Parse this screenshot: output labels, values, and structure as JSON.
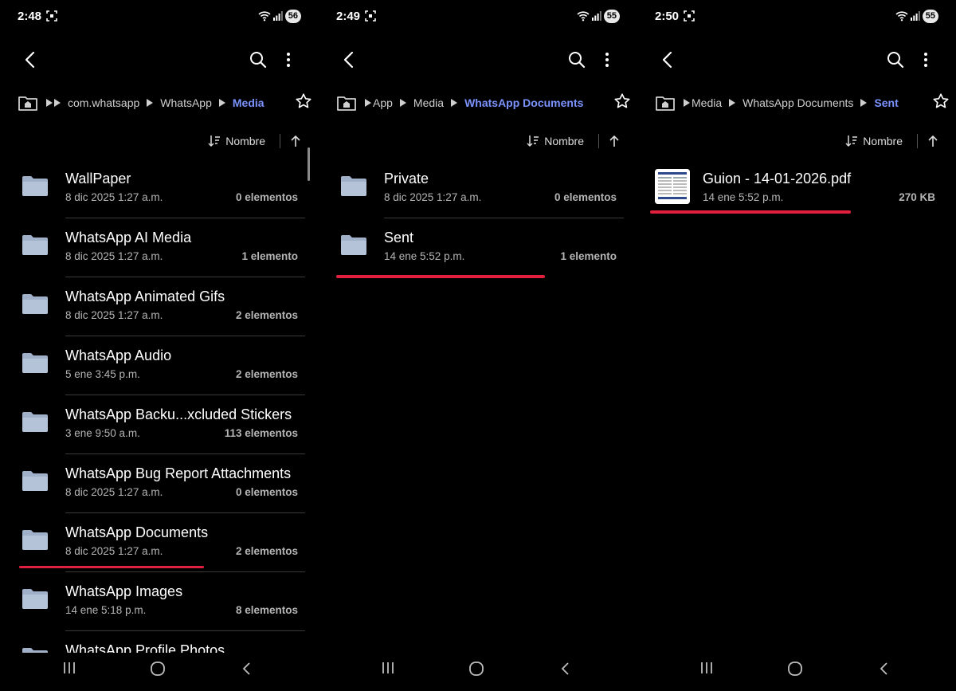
{
  "screens": [
    {
      "status": {
        "time": "2:48",
        "battery": "56"
      },
      "breadcrumbs": [
        "com.whatsapp",
        "WhatsApp",
        "Media"
      ],
      "sort_label": "Nombre",
      "items": [
        {
          "name": "WallPaper",
          "date": "8 dic 2025 1:27 a.m.",
          "count": "0 elementos"
        },
        {
          "name": "WhatsApp AI Media",
          "date": "8 dic 2025 1:27 a.m.",
          "count": "1 elemento"
        },
        {
          "name": "WhatsApp Animated Gifs",
          "date": "8 dic 2025 1:27 a.m.",
          "count": "2 elementos"
        },
        {
          "name": "WhatsApp Audio",
          "date": "5 ene 3:45 p.m.",
          "count": "2 elementos"
        },
        {
          "name": "WhatsApp Backu...xcluded Stickers",
          "date": "3 ene 9:50 a.m.",
          "count": "113 elementos"
        },
        {
          "name": "WhatsApp Bug Report Attachments",
          "date": "8 dic 2025 1:27 a.m.",
          "count": "0 elementos"
        },
        {
          "name": "WhatsApp Documents",
          "date": "8 dic 2025 1:27 a.m.",
          "count": "2 elementos"
        },
        {
          "name": "WhatsApp Images",
          "date": "14 ene 5:18 p.m.",
          "count": "8 elementos"
        },
        {
          "name": "WhatsApp Profile Photos",
          "date": "",
          "count": ""
        }
      ]
    },
    {
      "status": {
        "time": "2:49",
        "battery": "55"
      },
      "breadcrumbs": [
        "App",
        "Media",
        "WhatsApp Documents"
      ],
      "sort_label": "Nombre",
      "items": [
        {
          "name": "Private",
          "date": "8 dic 2025 1:27 a.m.",
          "count": "0 elementos"
        },
        {
          "name": "Sent",
          "date": "14 ene 5:52 p.m.",
          "count": "1 elemento"
        }
      ]
    },
    {
      "status": {
        "time": "2:50",
        "battery": "55"
      },
      "breadcrumbs": [
        "Media",
        "WhatsApp Documents",
        "Sent"
      ],
      "sort_label": "Nombre",
      "items": [
        {
          "name": "Guion - 14-01-2026.pdf",
          "date": "14 ene 5:52 p.m.",
          "count": "270 KB"
        }
      ]
    }
  ],
  "colors": {
    "accent": "#7b93ff",
    "highlight": "#e0203c",
    "folder": "#9fb0c8",
    "background": "#000000"
  }
}
